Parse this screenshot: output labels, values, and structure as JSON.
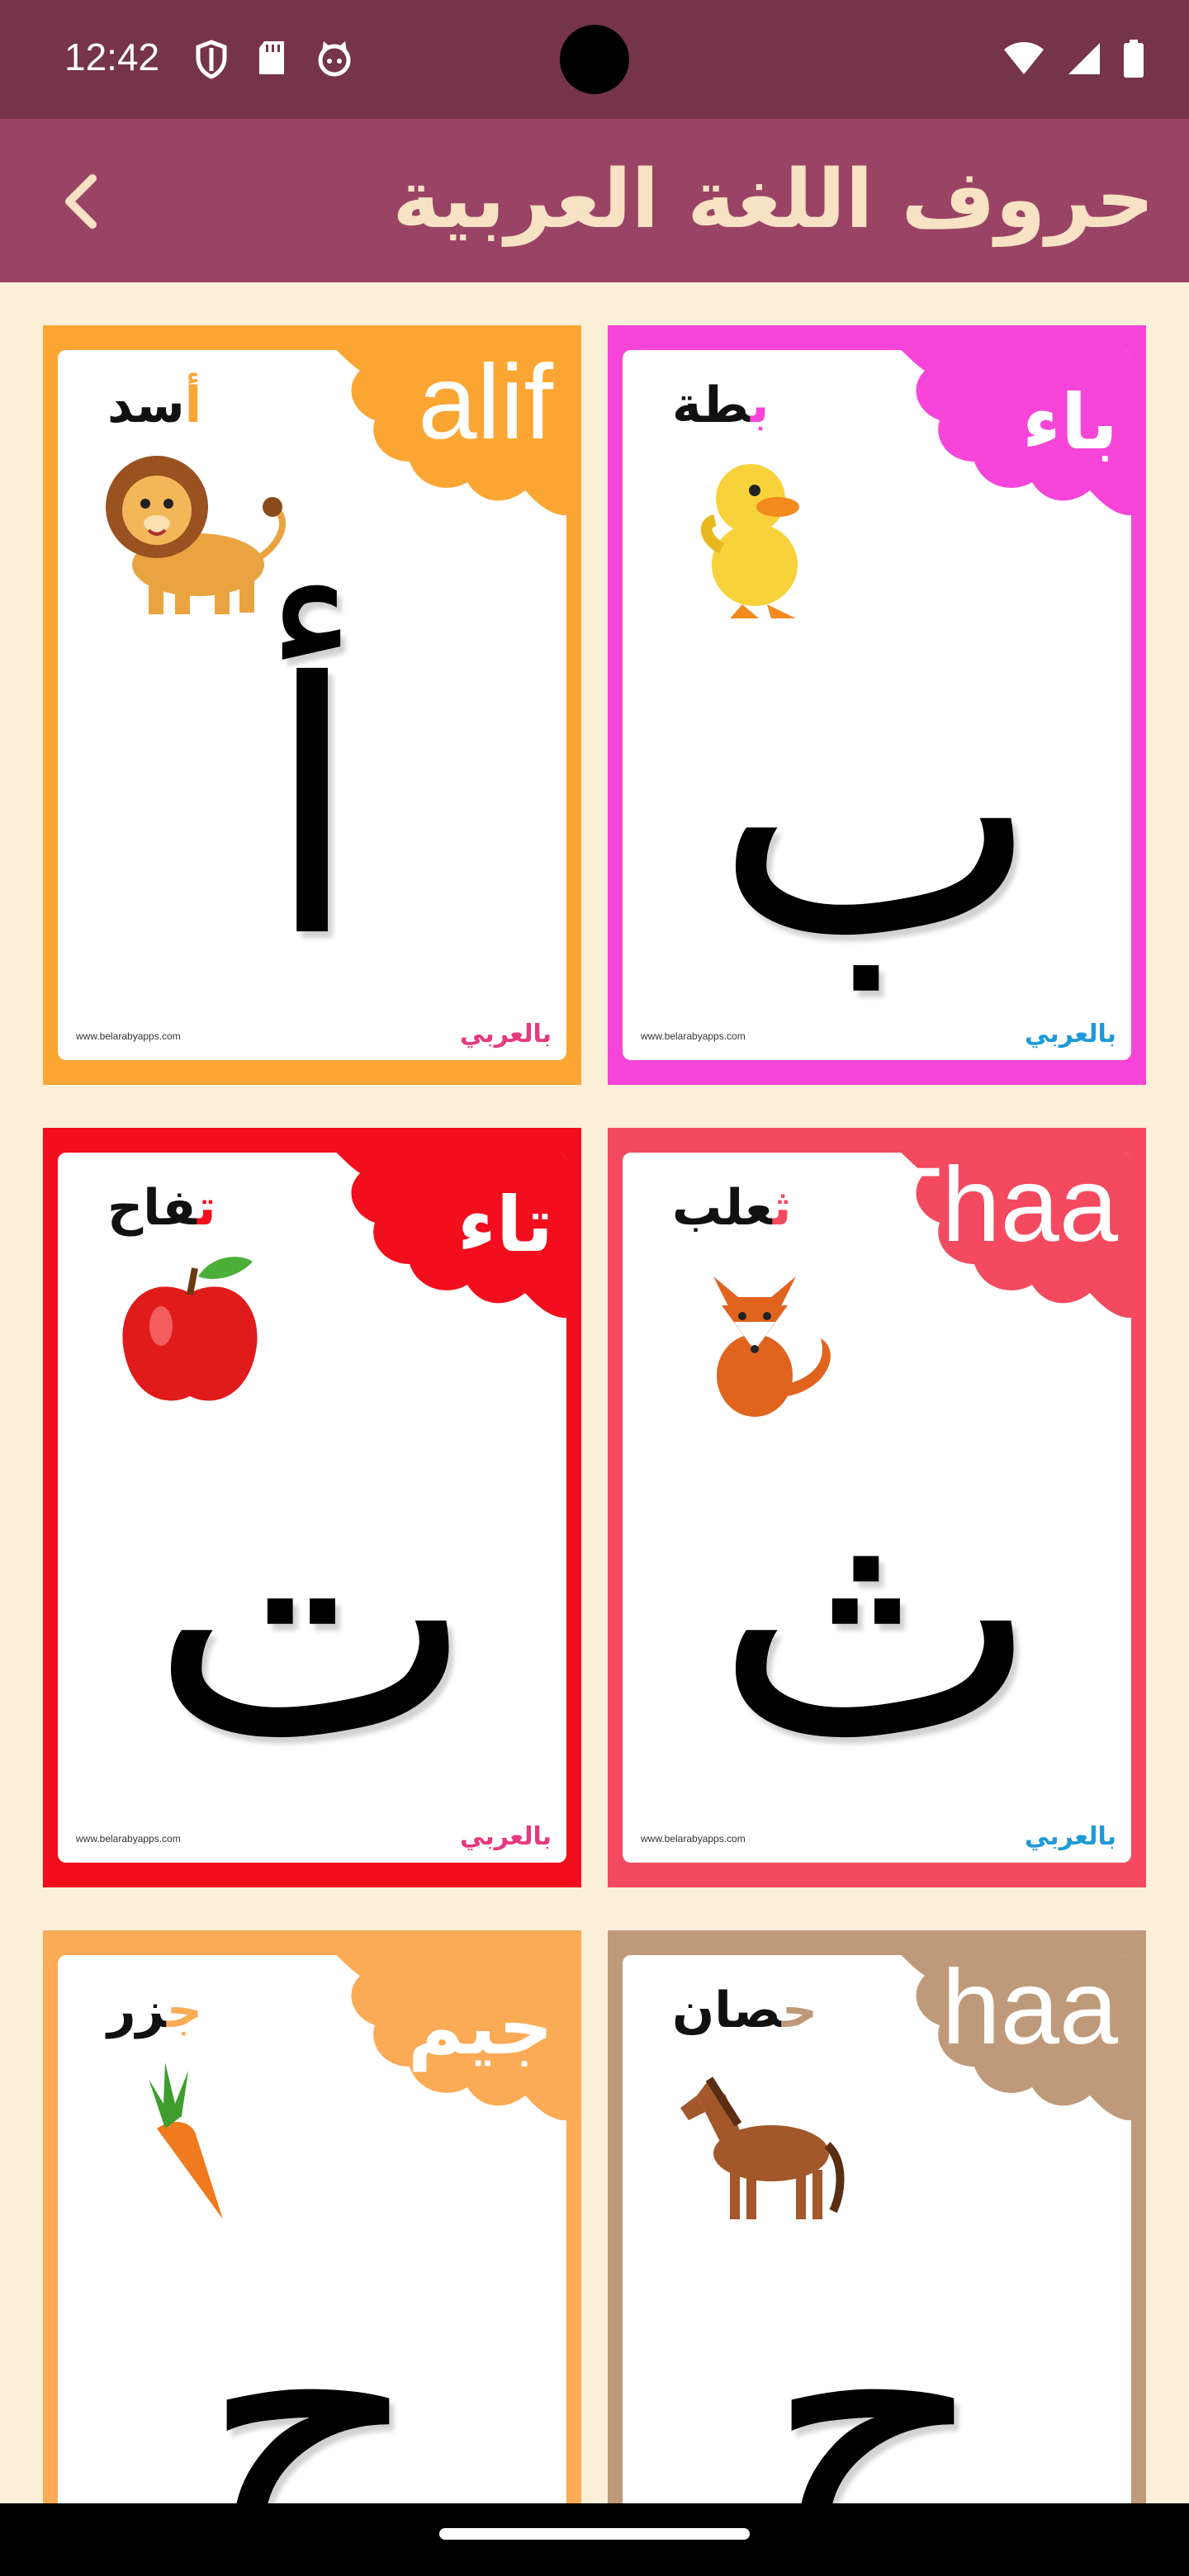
{
  "status": {
    "time": "12:42",
    "left_icons": [
      "shield-icon",
      "sd-card-icon",
      "cat-face-icon"
    ],
    "right_icons": [
      "wifi-icon",
      "signal-icon",
      "battery-icon"
    ]
  },
  "app_bar": {
    "title": "حروف اللغة العربية",
    "back_icon": "chevron-left-icon"
  },
  "cards": [
    {
      "letter": "أ",
      "name": "alif",
      "name_script": "latin",
      "word": "أسد",
      "word_first": "أ",
      "word_rest": "سد",
      "picture": "lion",
      "color": "#fba632",
      "url": "www.belarabyapps.com",
      "brand": "بالعربي"
    },
    {
      "letter": "ب",
      "name": "باء",
      "name_script": "arabic",
      "word": "بطة",
      "word_first": "ب",
      "word_rest": "طة",
      "picture": "duckling",
      "color": "#f645d8",
      "url": "www.belarabyapps.com",
      "brand": "بالعربي"
    },
    {
      "letter": "ت",
      "name": "تاء",
      "name_script": "arabic",
      "word": "تفاح",
      "word_first": "ت",
      "word_rest": "فاح",
      "picture": "apple",
      "color": "#f20e1c",
      "url": "www.belarabyapps.com",
      "brand": "بالعربي"
    },
    {
      "letter": "ث",
      "name": "Thaa",
      "name_script": "latin",
      "word": "ثعلب",
      "word_first": "ث",
      "word_rest": "علب",
      "picture": "fox",
      "color": "#f34a60",
      "url": "www.belarabyapps.com",
      "brand": "بالعربي"
    },
    {
      "letter": "ج",
      "name": "جيم",
      "name_script": "arabic",
      "word": "جزر",
      "word_first": "ج",
      "word_rest": "زر",
      "picture": "carrot",
      "color": "#fbaa55",
      "url": "",
      "brand": ""
    },
    {
      "letter": "ح",
      "name": "haa",
      "name_script": "latin",
      "word": "حصان",
      "word_first": "ح",
      "word_rest": "صان",
      "picture": "horse",
      "color": "#bf9a7a",
      "url": "",
      "brand": ""
    }
  ]
}
